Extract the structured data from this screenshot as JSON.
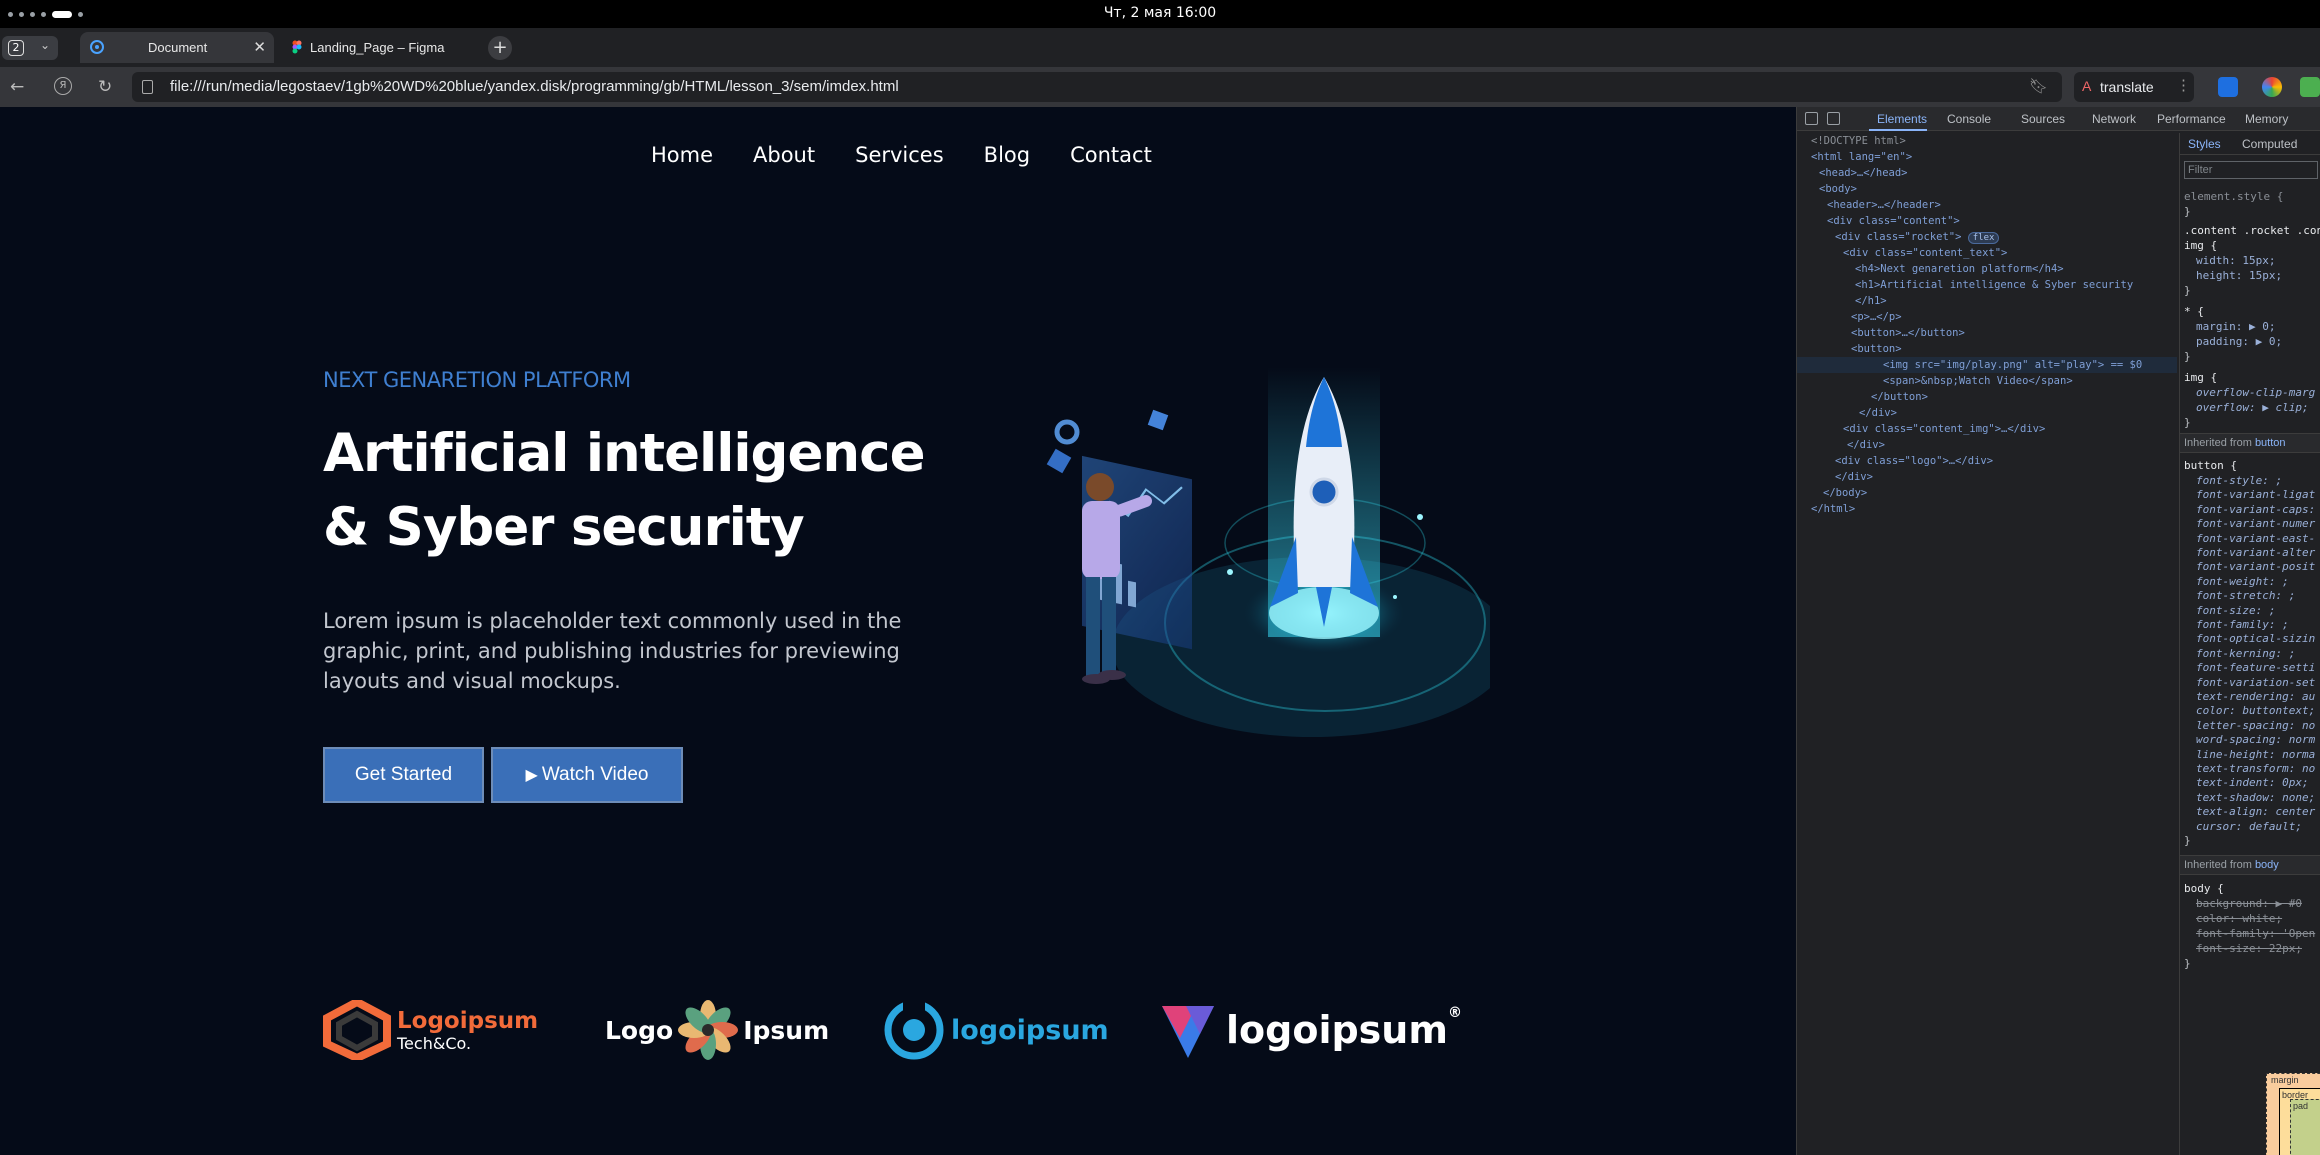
{
  "os": {
    "clock": "Чт, 2 мая  16:00"
  },
  "browser": {
    "workspace_number": "2",
    "tabs": [
      {
        "label": "Document",
        "active": true
      },
      {
        "label": "Landing_Page – Figma",
        "active": false
      }
    ],
    "url": "file:///run/media/legostaev/1gb%20WD%20blue/yandex.disk/programming/gb/HTML/lesson_3/sem/imdex.html",
    "translate_label": "translate"
  },
  "page": {
    "nav": [
      "Home",
      "About",
      "Services",
      "Blog",
      "Contact"
    ],
    "eyebrow": "NEXT GENARETION PLATFORM",
    "title": "Artificial intelligence & Syber security",
    "lead": "Lorem ipsum is placeholder text commonly used in the graphic, print, and publishing industries for previewing layouts and visual mockups.",
    "buttons": {
      "primary": "Get Started",
      "secondary": "Watch Video",
      "secondary_icon": "▶"
    },
    "logos": [
      {
        "name": "Logoipsum",
        "sub": "Tech&Co.",
        "accent": "#f26b3a"
      },
      {
        "name_left": "Logo",
        "name_right": "Ipsum"
      },
      {
        "name": "logoipsum",
        "accent": "#2aa7e0"
      },
      {
        "name": "logoipsum",
        "mark": "®"
      }
    ],
    "colors": {
      "background": "#050b18",
      "accent": "#3a6fb8",
      "eyebrow": "#3f7fd0"
    }
  },
  "devtools": {
    "tabs": [
      "Elements",
      "Console",
      "Sources",
      "Network",
      "Performance",
      "Memory"
    ],
    "active_tab": "Elements",
    "dom": [
      {
        "text": "<!DOCTYPE html>"
      },
      {
        "text": "<html lang=\"en\">"
      },
      {
        "text": "<head>…</head>"
      },
      {
        "text": "<body>"
      },
      {
        "text": "<header>…</header>"
      },
      {
        "text": "<div class=\"content\">"
      },
      {
        "text": "<div class=\"rocket\">",
        "badge": "flex"
      },
      {
        "text": "<div class=\"content_text\">"
      },
      {
        "text": "<h4>Next genaretion platform</h4>"
      },
      {
        "text": "<h1>Artificial intelligence & Syber security"
      },
      {
        "text": "</h1>"
      },
      {
        "text": "<p>…</p>"
      },
      {
        "text": "<button>…</button>"
      },
      {
        "text": "<button>"
      },
      {
        "text": "<img src=\"img/play.png\" alt=\"play\"> == $0"
      },
      {
        "text": "<span>&nbsp;Watch Video</span>"
      },
      {
        "text": "</button>"
      },
      {
        "text": "</div>"
      },
      {
        "text": "<div class=\"content_img\">…</div>"
      },
      {
        "text": "</div>"
      },
      {
        "text": "<div class=\"logo\">…</div>"
      },
      {
        "text": "</div>"
      },
      {
        "text": "</body>"
      },
      {
        "text": "</html>"
      }
    ],
    "styles_tabs": [
      "Styles",
      "Computed"
    ],
    "filter_placeholder": "Filter",
    "styles": {
      "element_style": "element.style {",
      "rule1_selector": ".content .rocket .con",
      "rule1_selector2": "img {",
      "rule1_props": [
        "width: 15px;",
        "height: 15px;"
      ],
      "rule2_selector": "* {",
      "rule2_props": [
        "margin: ▶ 0;",
        "padding: ▶ 0;"
      ],
      "rule3_selector": "img {",
      "rule3_props": [
        "overflow-clip-marg",
        "overflow: ▶ clip;"
      ],
      "inherited_button": "Inherited from",
      "inherited_button_el": "button",
      "button_selector": "button {",
      "button_props": [
        "font-style: ;",
        "font-variant-ligat",
        "font-variant-caps:",
        "font-variant-numer",
        "font-variant-east-",
        "font-variant-alter",
        "font-variant-posit",
        "font-weight: ;",
        "font-stretch: ;",
        "font-size: ;",
        "font-family: ;",
        "font-optical-sizin",
        "font-kerning: ;",
        "font-feature-setti",
        "font-variation-set",
        "text-rendering: au",
        "color: buttontext;",
        "letter-spacing: no",
        "word-spacing: norm",
        "line-height: norma",
        "text-transform: no",
        "text-indent: 0px;",
        "text-shadow: none;",
        "text-align: center",
        "cursor: default;"
      ],
      "inherited_body": "Inherited from",
      "inherited_body_el": "body",
      "body_selector": "body {",
      "body_props": [
        "background: ▶ #0",
        "color: white;",
        "font-family: 'Open",
        "font-size: 22px;"
      ],
      "close": "}",
      "box_margin": "margin",
      "box_border": "border",
      "box_padding": "pad"
    }
  }
}
